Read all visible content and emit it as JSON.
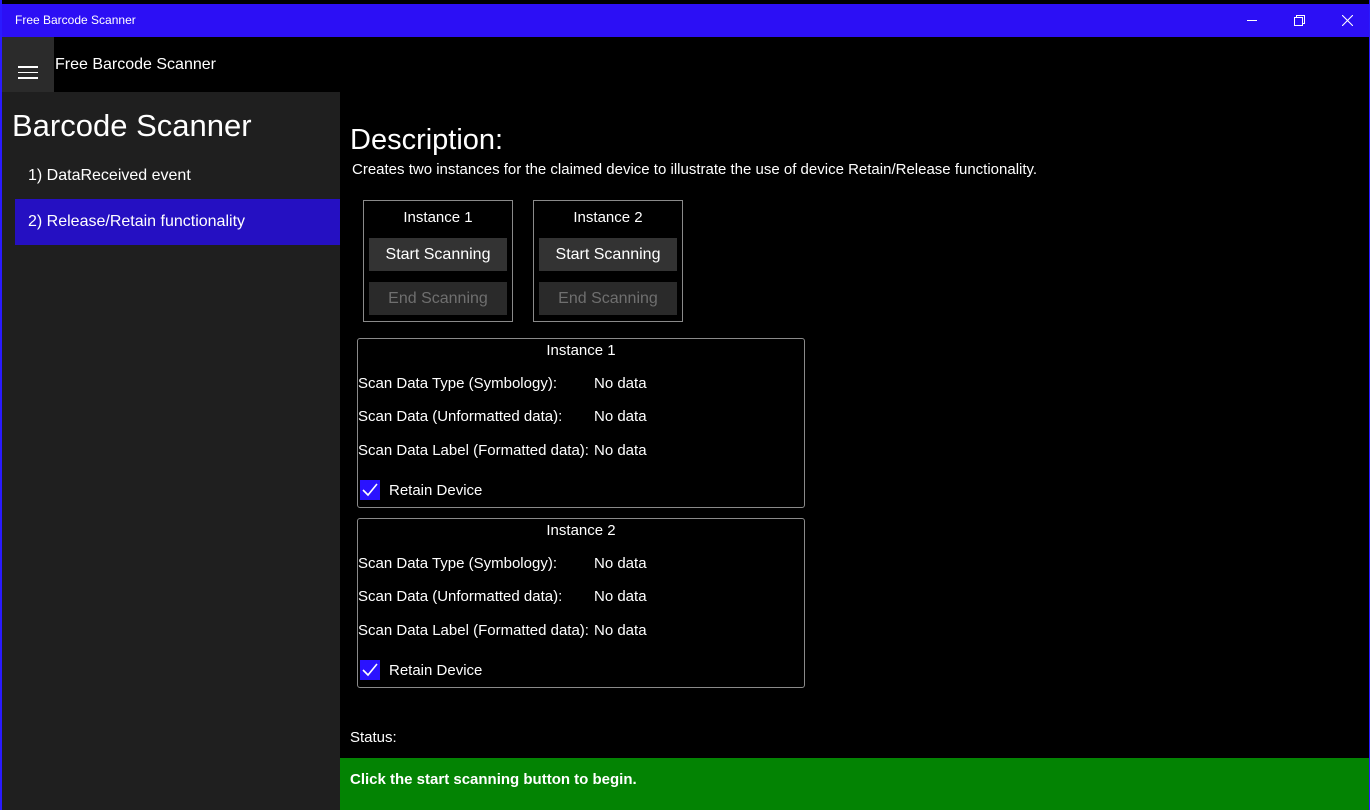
{
  "window": {
    "title": "Free Barcode Scanner",
    "controls": {
      "minimize": "minimize-icon",
      "restore": "restore-icon",
      "close": "close-icon"
    }
  },
  "header": {
    "menu_icon": "hamburger-icon",
    "app_title": "Free Barcode Scanner"
  },
  "sidebar": {
    "title": "Barcode Scanner",
    "items": [
      {
        "label": "1) DataReceived event",
        "selected": false
      },
      {
        "label": "2) Release/Retain functionality",
        "selected": true
      }
    ]
  },
  "main": {
    "description_heading": "Description:",
    "description_text": "Creates two instances for the claimed device to illustrate the use of device Retain/Release functionality.",
    "controls": [
      {
        "label": "Instance 1",
        "start_label": "Start Scanning",
        "end_label": "End Scanning"
      },
      {
        "label": "Instance 2",
        "start_label": "Start Scanning",
        "end_label": "End Scanning"
      }
    ],
    "panels": [
      {
        "title": "Instance 1",
        "symbology_label": "Scan Data Type (Symbology):",
        "symbology_value": "No data",
        "unformatted_label": "Scan Data (Unformatted data):",
        "unformatted_value": "No data",
        "formatted_label": "Scan Data Label (Formatted data):",
        "formatted_value": "No data",
        "retain_label": "Retain Device",
        "retain_checked": true
      },
      {
        "title": "Instance 2",
        "symbology_label": "Scan Data Type (Symbology):",
        "symbology_value": "No data",
        "unformatted_label": "Scan Data (Unformatted data):",
        "unformatted_value": "No data",
        "formatted_label": "Scan Data Label (Formatted data):",
        "formatted_value": "No data",
        "retain_label": "Retain Device",
        "retain_checked": true
      }
    ],
    "status_label": "Status:",
    "status_message": "Click the start scanning button to begin."
  },
  "colors": {
    "titlebar": "#2c0ff5",
    "accent_selected": "#2510c2",
    "checkbox": "#2a12ff",
    "status_ok": "#038303"
  }
}
